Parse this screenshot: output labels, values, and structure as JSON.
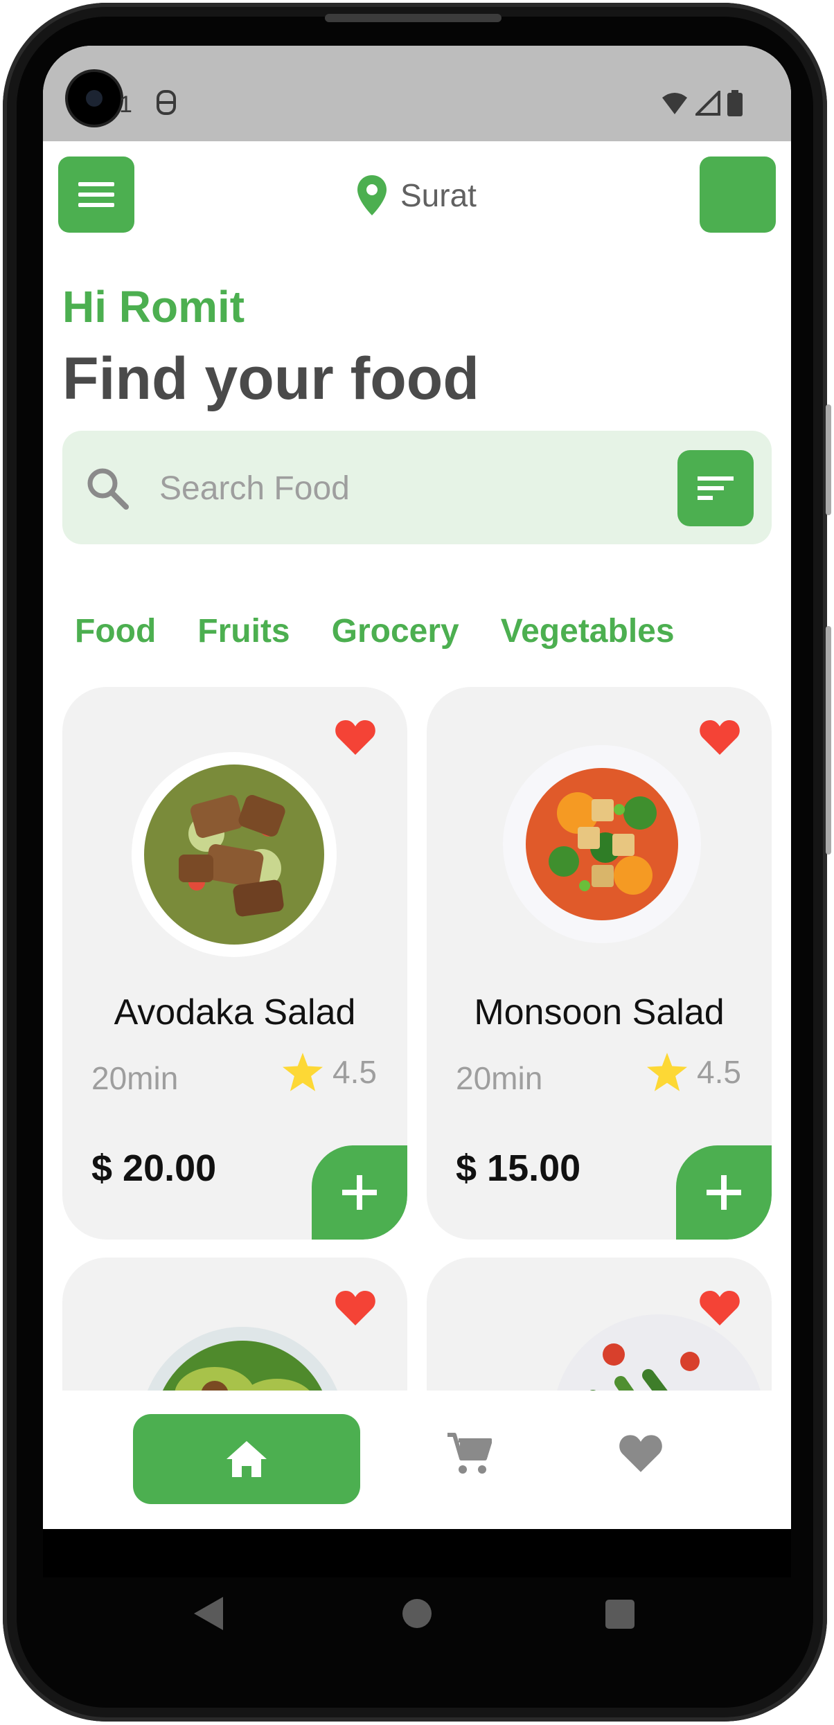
{
  "location": {
    "city": "Surat",
    "icon": "location-pin-icon"
  },
  "greeting": "Hi Romit",
  "headline": "Find your food",
  "search": {
    "placeholder": "Search Food",
    "icon": "search-icon",
    "filter_icon": "filter-icon"
  },
  "categories": [
    "Food",
    "Fruits",
    "Grocery",
    "Vegetables"
  ],
  "products": [
    {
      "name": "Avodaka Salad",
      "time": "20min",
      "rating": "4.5",
      "price": "$ 20.00",
      "favorite": true
    },
    {
      "name": "Monsoon Salad",
      "time": "20min",
      "rating": "4.5",
      "price": "$ 15.00",
      "favorite": true
    },
    {
      "name": "",
      "favorite": true
    },
    {
      "name": "",
      "favorite": true
    }
  ],
  "bottom_nav": [
    {
      "icon": "home-icon",
      "active": true
    },
    {
      "icon": "cart-icon",
      "active": false
    },
    {
      "icon": "heart-icon",
      "active": false
    }
  ],
  "colors": {
    "accent": "#4caf50",
    "heart": "#f44336",
    "star": "#fdd835",
    "card": "#f2f2f2",
    "search_bg": "#e6f3e6"
  }
}
